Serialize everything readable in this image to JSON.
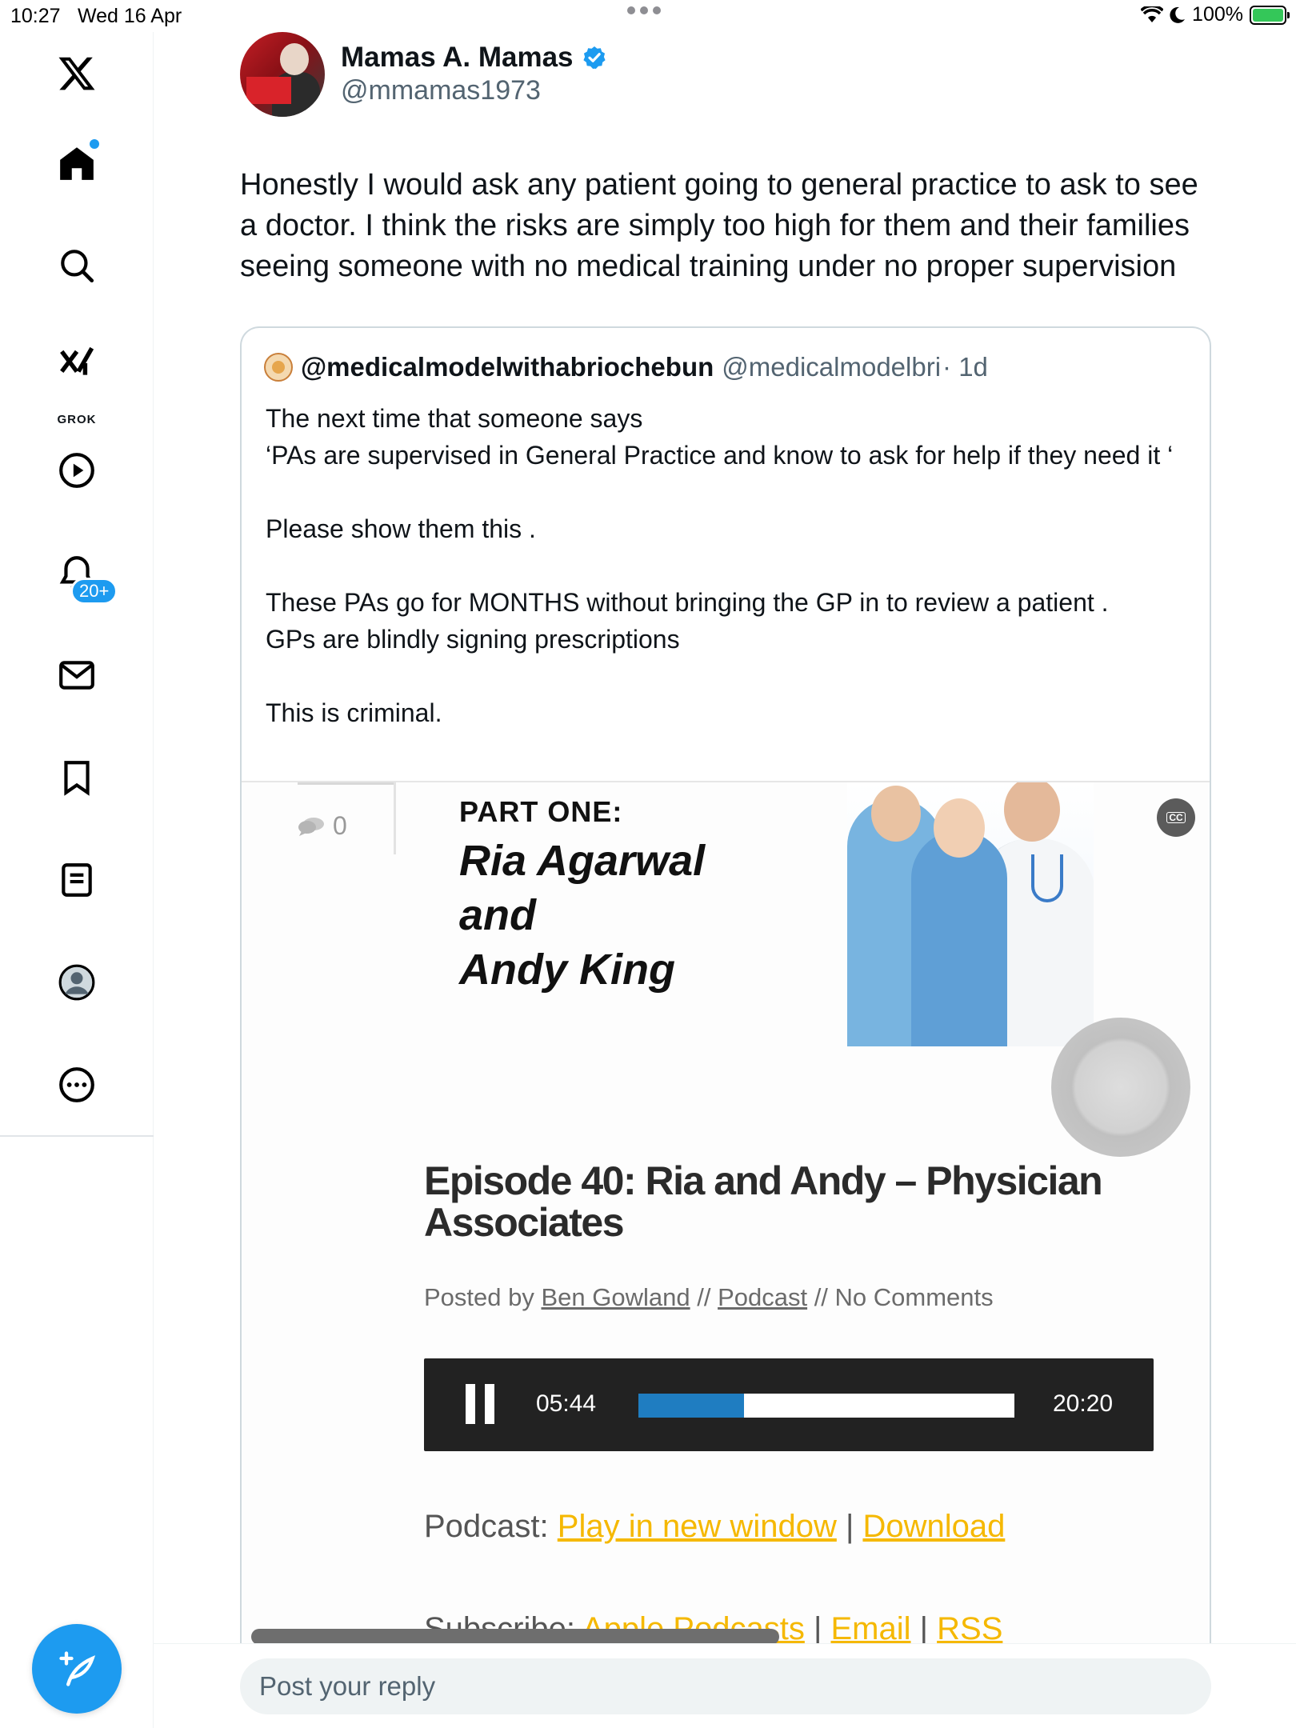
{
  "status_bar": {
    "time": "10:27",
    "date": "Wed 16 Apr",
    "battery": "100%"
  },
  "sidebar": {
    "items": [
      {
        "name": "x-logo-icon"
      },
      {
        "name": "home-icon"
      },
      {
        "name": "search-icon"
      },
      {
        "name": "grok-icon",
        "label": "GROK"
      },
      {
        "name": "video-icon"
      },
      {
        "name": "notifications-icon",
        "badge": "20+"
      },
      {
        "name": "messages-icon"
      },
      {
        "name": "bookmarks-icon"
      },
      {
        "name": "lists-icon"
      },
      {
        "name": "profile-icon"
      },
      {
        "name": "more-icon"
      }
    ]
  },
  "tweet": {
    "author_name": "Mamas A. Mamas",
    "author_handle": "@mmamas1973",
    "text": "Honestly I would ask any patient going to general practice to ask to see a doctor. I think the risks are simply too high for them and their families seeing someone with no medical training under no proper supervision",
    "quote": {
      "name": "@medicalmodelwithabriochebun",
      "handle": "@medicalmodelbri",
      "time": "· 1d",
      "text": "The next time that someone says\n‘PAs are supervised in General Practice and know to ask for help if they need it ‘\n\nPlease show them this .\n\nThese PAs go for MONTHS without bringing the GP in to review a patient .\nGPs are blindly signing prescriptions\n\nThis is criminal.",
      "media": {
        "comment_count": "0",
        "part_label": "PART ONE:",
        "names": [
          "Ria Agarwal",
          "and",
          "Andy King"
        ],
        "cc_label": "CC",
        "episode_title": "Episode 40: Ria and Andy – Physician Associates",
        "posted_by": {
          "prefix": "Posted by ",
          "author": "Ben Gowland",
          "sep1": " // ",
          "category": "Podcast",
          "sep2": " // No Comments"
        },
        "player": {
          "current_time": "05:44",
          "total_time": "20:20",
          "progress": 0.28
        },
        "podcast_line": {
          "label": "Podcast: ",
          "play_link": "Play in new window",
          "sep": " | ",
          "download_link": "Download"
        },
        "subscribe_line": {
          "label": "Subscribe: ",
          "apple": "Apple Podcasts",
          "sep1": " | ",
          "email": "Email",
          "sep2": " | ",
          "rss": "RSS"
        }
      }
    }
  },
  "reply": {
    "placeholder": "Post your reply"
  },
  "colors": {
    "accent": "#1d9bf0",
    "link_orange": "#f5b800",
    "player_bg": "#222222",
    "progress": "#1f7dc1"
  }
}
